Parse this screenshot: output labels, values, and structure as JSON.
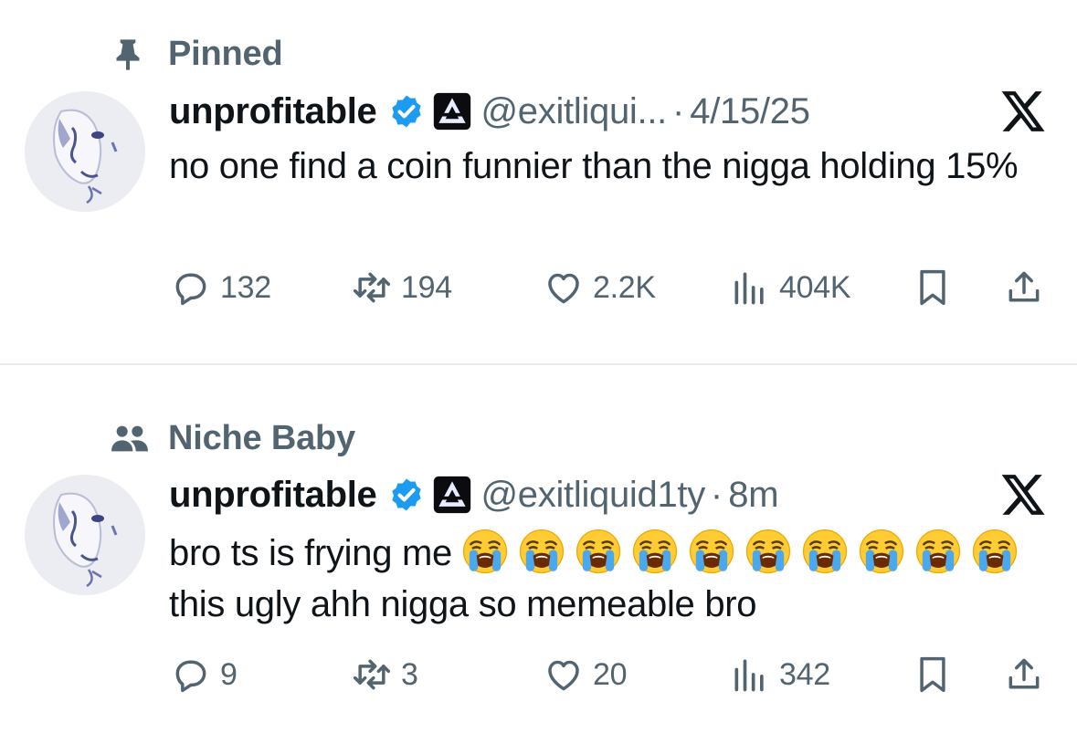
{
  "tweets": [
    {
      "context_label": "Pinned",
      "context_icon": "pin-icon",
      "author_name": "unprofitable",
      "handle": "@exitliqui...",
      "separator": "·",
      "timestamp": "4/15/25",
      "text": "no one find a coin funnier than the nigga holding 15%",
      "stats": {
        "replies": "132",
        "reposts": "194",
        "likes": "2.2K",
        "views": "404K"
      }
    },
    {
      "context_label": "Niche Baby",
      "context_icon": "community-icon",
      "author_name": "unprofitable",
      "handle": "@exitliquid1ty",
      "separator": "·",
      "timestamp": "8m",
      "text_lead": "bro ts is frying me",
      "emoji_count": 10,
      "emoji_name": "loudly-crying-face-emoji",
      "text_tail": "this ugly ahh nigga so memeable bro",
      "stats": {
        "replies": "9",
        "reposts": "3",
        "likes": "20",
        "views": "342"
      }
    }
  ],
  "colors": {
    "text_primary": "#0f1419",
    "text_secondary": "#536471",
    "verified_blue": "#1d9bf0",
    "divider": "#e7e9ea"
  }
}
